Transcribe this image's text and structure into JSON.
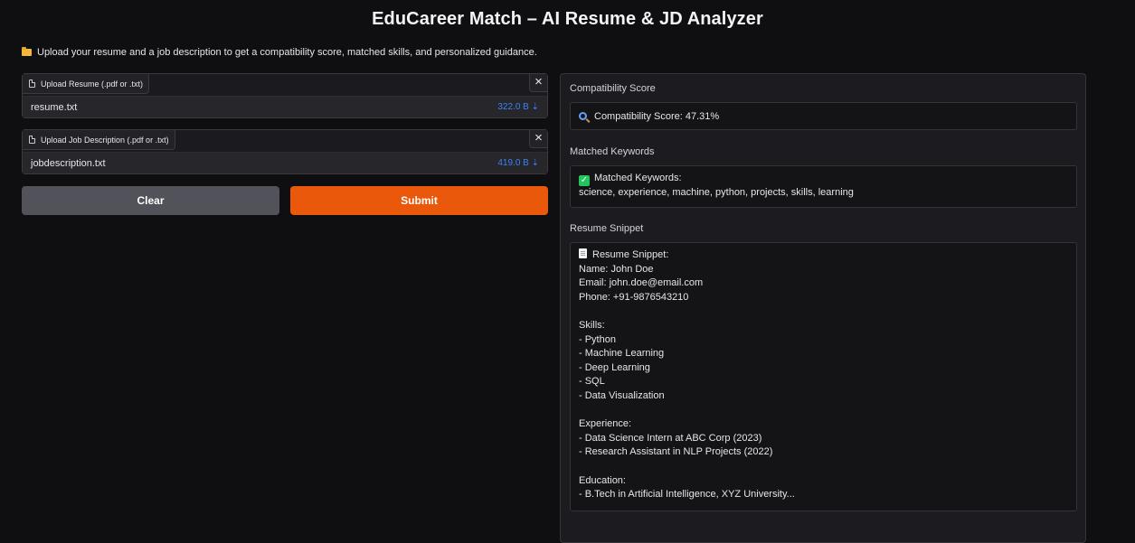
{
  "app": {
    "title": "EduCareer Match – AI Resume & JD Analyzer",
    "subtitle": "Upload your resume and a job description to get a compatibility score, matched skills, and personalized guidance."
  },
  "uploads": [
    {
      "label": "Upload Resume (.pdf or .txt)",
      "file_name": "resume.txt",
      "file_size": "322.0 B ⇣",
      "close": "×"
    },
    {
      "label": "Upload Job Description (.pdf or .txt)",
      "file_name": "jobdescription.txt",
      "file_size": "419.0 B ⇣",
      "close": "×"
    }
  ],
  "buttons": {
    "clear": "Clear",
    "submit": "Submit"
  },
  "output": {
    "score_label": "Compatibility Score",
    "score_text": "Compatibility Score: 47.31%",
    "keywords_label": "Matched Keywords",
    "keywords_title": "Matched Keywords:",
    "keywords_list": "science, experience, machine, python, projects, skills, learning",
    "snippet_label": "Resume Snippet",
    "snippet_title": "Resume Snippet:",
    "snippet_body": "Name: John Doe\nEmail: john.doe@email.com\nPhone: +91-9876543210\n\nSkills:\n- Python\n- Machine Learning\n- Deep Learning\n- SQL\n- Data Visualization\n\nExperience:\n- Data Science Intern at ABC Corp (2023)\n- Research Assistant in NLP Projects (2022)\n\nEducation:\n- B.Tech in Artificial Intelligence, XYZ University..."
  },
  "icons": {
    "subtitle": "folder-icon",
    "upload": "file-icon",
    "score": "magnifier-icon",
    "keywords": "check-icon",
    "snippet": "document-icon"
  },
  "colors": {
    "background": "#0f0f11",
    "submit": "#ea580c",
    "clear": "#52525b",
    "file_size": "#3b82f6"
  }
}
